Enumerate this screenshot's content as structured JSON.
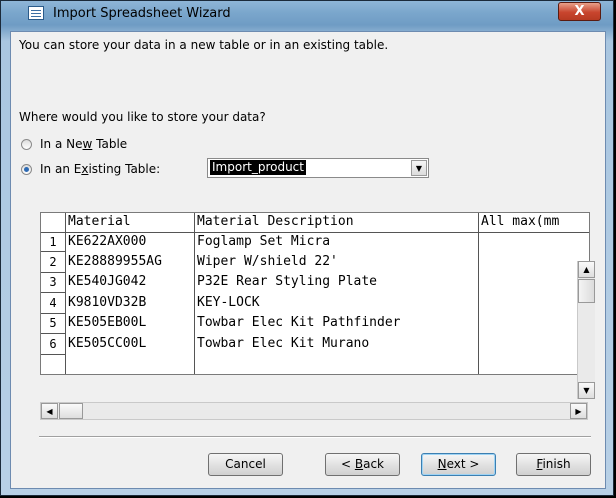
{
  "window": {
    "title": "Import Spreadsheet Wizard",
    "close_glyph": "X"
  },
  "intro_text": "You can store your data in a new table or in an existing table.",
  "question_text": "Where would you like to store your data?",
  "options": [
    {
      "label_pre": "In a Ne",
      "label_accel": "w",
      "label_post": " Table",
      "checked": false
    },
    {
      "label_pre": "In an E",
      "label_accel": "x",
      "label_post": "isting Table:",
      "checked": true
    }
  ],
  "existing_table": {
    "value": "Import_product"
  },
  "grid": {
    "columns": [
      "Material",
      "Material Description",
      "All max(mm"
    ],
    "rows": [
      {
        "num": "1",
        "material": "KE622AX000",
        "description": "Foglamp Set Micra"
      },
      {
        "num": "2",
        "material": "KE28889955AG",
        "description": "Wiper W/shield 22'"
      },
      {
        "num": "3",
        "material": "KE540JG042",
        "description": "P32E Rear Styling Plate"
      },
      {
        "num": "4",
        "material": "K9810VD32B",
        "description": "KEY-LOCK"
      },
      {
        "num": "5",
        "material": "KE505EB00L",
        "description": "Towbar Elec Kit Pathfinder"
      },
      {
        "num": "6",
        "material": "KE505CC00L",
        "description": "Towbar Elec Kit Murano"
      }
    ]
  },
  "buttons": {
    "cancel": "Cancel",
    "back_pre": "< ",
    "back_accel": "B",
    "back_post": "ack",
    "next_accel": "N",
    "next_post": "ext >",
    "finish_accel": "F",
    "finish_post": "inish"
  },
  "icons": [
    "wizard-window-icon",
    "close-icon",
    "dropdown-arrow-icon",
    "scroll-up-icon",
    "scroll-down-icon",
    "scroll-left-icon",
    "scroll-right-icon"
  ]
}
